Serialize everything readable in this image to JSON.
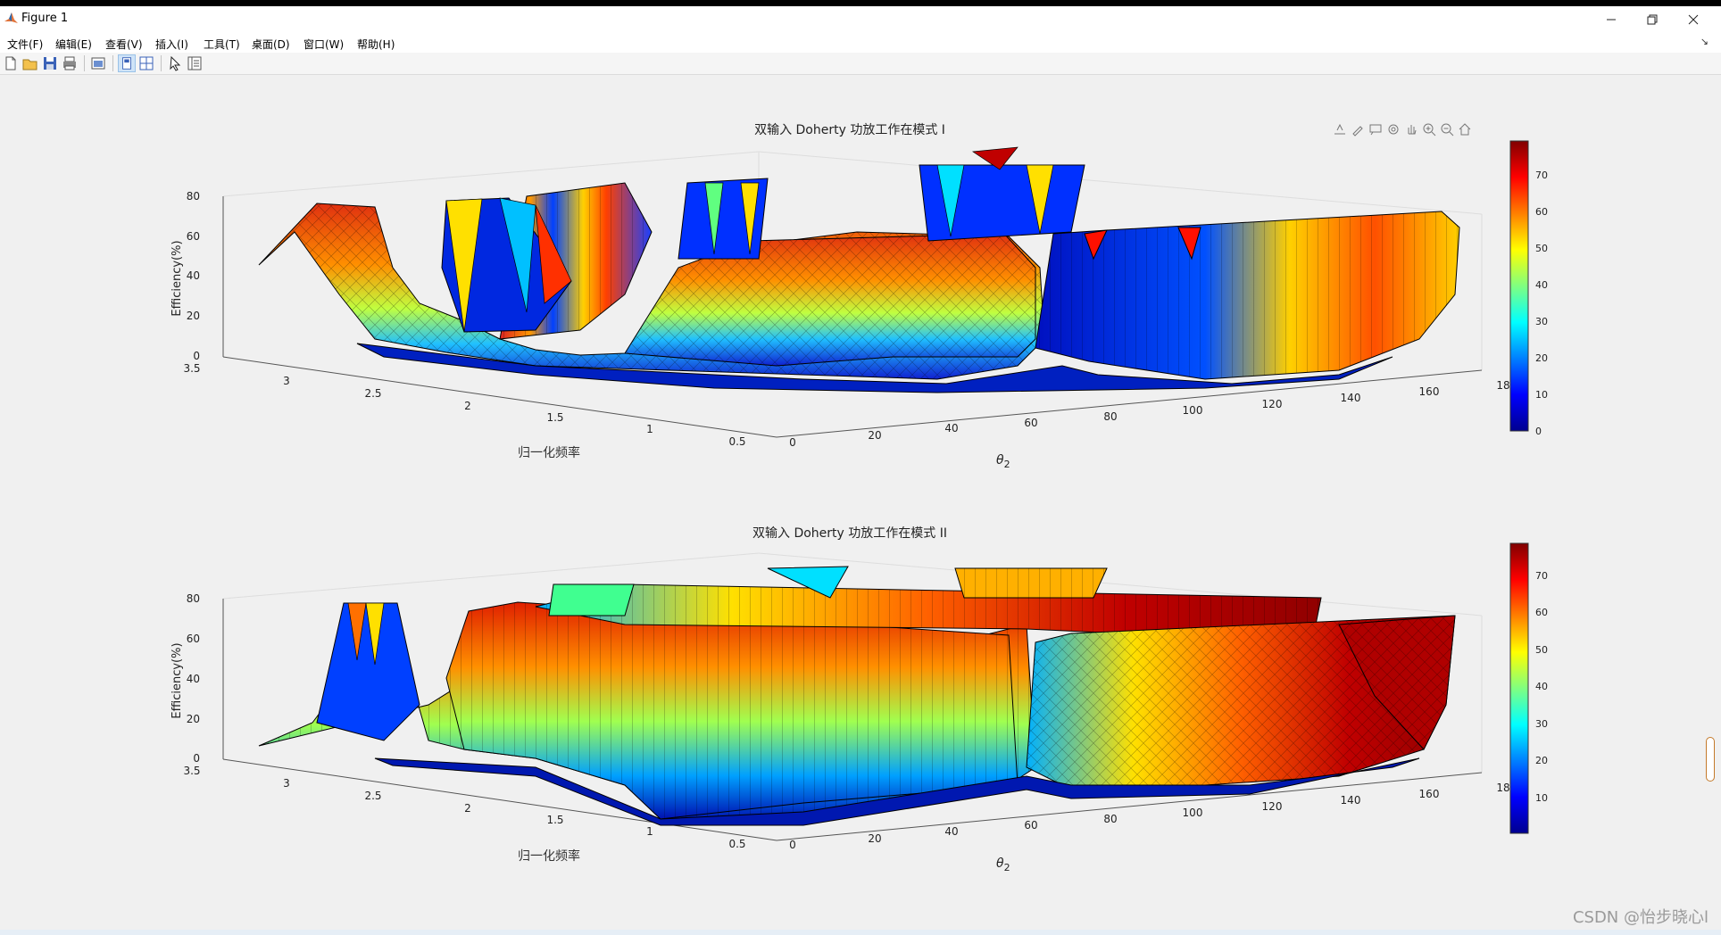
{
  "window": {
    "title": "Figure 1"
  },
  "menu": [
    "文件(F)",
    "编辑(E)",
    "查看(V)",
    "插入(I)",
    "工具(T)",
    "桌面(D)",
    "窗口(W)",
    "帮助(H)"
  ],
  "plots": [
    {
      "title": "双输入 Doherty 功放工作在模式 I",
      "zlabel": "Efficiency(%)",
      "ylabel": "归一化频率",
      "xlabel_theta": "θ",
      "xlabel_sub": "2",
      "zticks": [
        "0",
        "20",
        "40",
        "60",
        "80"
      ],
      "yticks": [
        "0.5",
        "1",
        "1.5",
        "2",
        "2.5",
        "3",
        "3.5"
      ],
      "xticks": [
        "0",
        "20",
        "40",
        "60",
        "80",
        "100",
        "120",
        "140",
        "160",
        "18"
      ],
      "colorbar_ticks": [
        "0",
        "10",
        "20",
        "30",
        "40",
        "50",
        "60",
        "70"
      ]
    },
    {
      "title": "双输入 Doherty 功放工作在模式 II",
      "zlabel": "Efficiency(%)",
      "ylabel": "归一化频率",
      "xlabel_theta": "θ",
      "xlabel_sub": "2",
      "zticks": [
        "0",
        "20",
        "40",
        "60",
        "80"
      ],
      "yticks": [
        "0.5",
        "1",
        "1.5",
        "2",
        "2.5",
        "3",
        "3.5"
      ],
      "xticks": [
        "0",
        "20",
        "40",
        "60",
        "80",
        "100",
        "120",
        "140",
        "160",
        "18"
      ],
      "colorbar_ticks": [
        "10",
        "20",
        "30",
        "40",
        "50",
        "60",
        "70"
      ]
    }
  ],
  "axes_toolbar_icons": [
    "export-icon",
    "brush-icon",
    "datatip-icon",
    "rotate-icon",
    "pan-icon",
    "zoom-in-icon",
    "zoom-out-icon",
    "home-icon"
  ],
  "watermark": "CSDN @怡步晓心l",
  "colors": {
    "colormap": "jet",
    "edge": "#000000",
    "background": "#f0f0f0"
  }
}
